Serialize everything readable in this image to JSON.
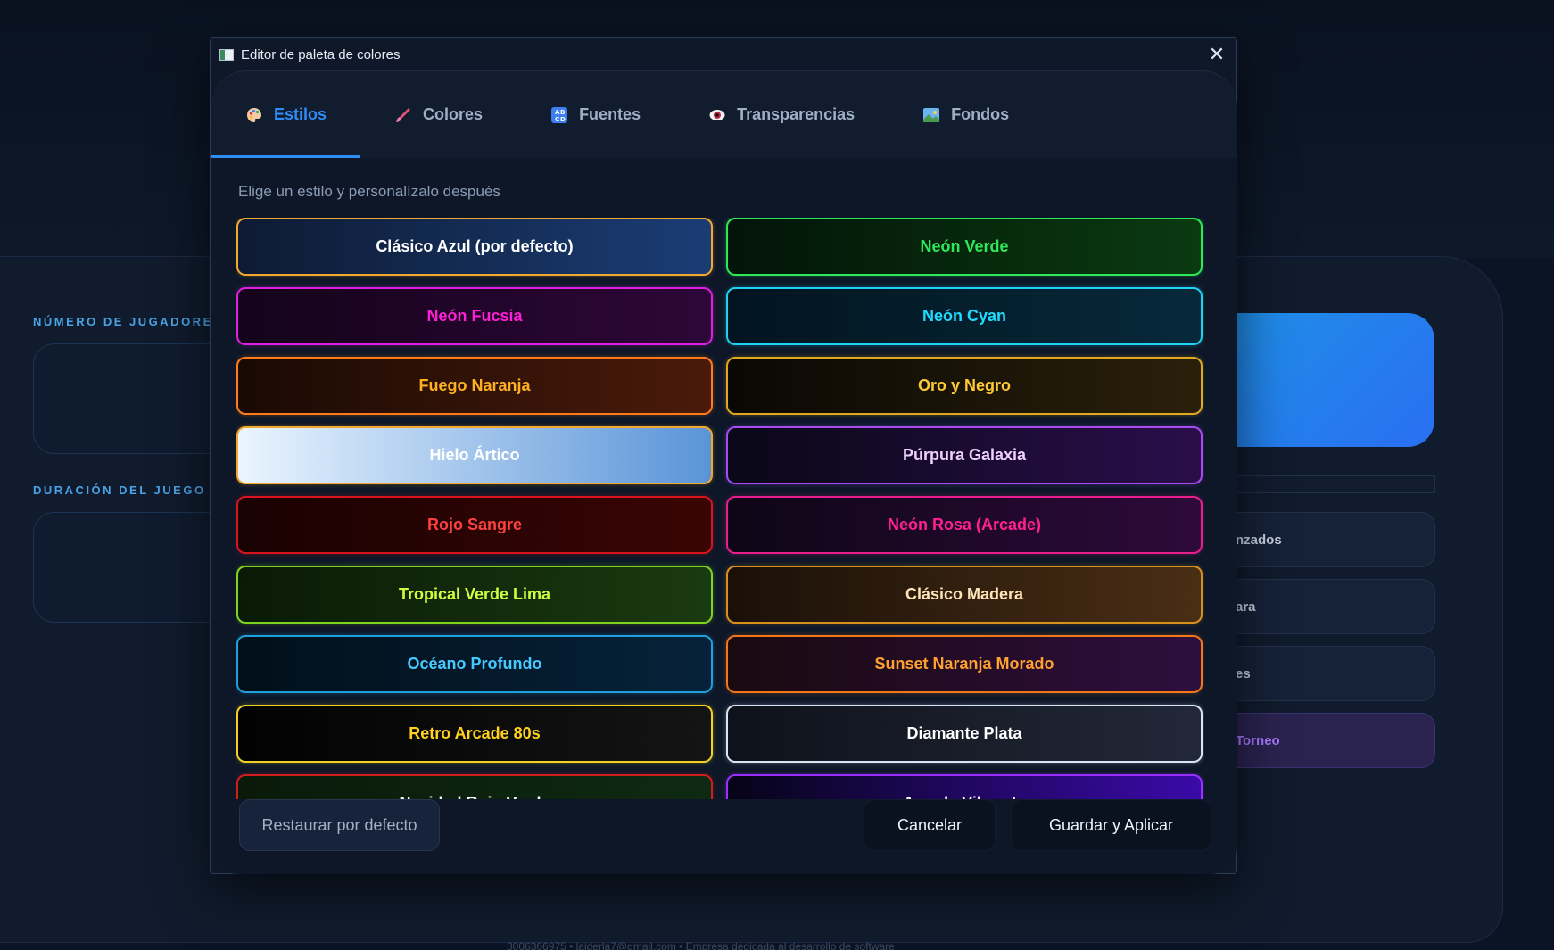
{
  "background": {
    "label_players": "NÚMERO DE JUGADORES",
    "label_duration": "DURACIÓN DEL JUEGO",
    "side_buttons": [
      "nzados",
      "ara",
      "es",
      "Torneo"
    ],
    "footer": "3006366975  •  laiderla7@gmail.com  •  Empresa dedicada al desarrollo de software"
  },
  "dialog": {
    "title": "Editor de paleta de colores",
    "close_symbol": "✕",
    "tabs": [
      {
        "label": "Estilos",
        "icon": "palette-icon",
        "active": true
      },
      {
        "label": "Colores",
        "icon": "brush-icon",
        "active": false
      },
      {
        "label": "Fuentes",
        "icon": "font-grid-icon",
        "active": false
      },
      {
        "label": "Transparencias",
        "icon": "eye-icon",
        "active": false
      },
      {
        "label": "Fondos",
        "icon": "picture-icon",
        "active": false
      }
    ],
    "subtitle": "Elige un estilo y personalízalo después",
    "styles": [
      {
        "name": "Clásico Azul (por defecto)",
        "text": "#ffffff",
        "border": "#f0a830",
        "bg1": "#0e1a33",
        "bg2": "#1a3d75"
      },
      {
        "name": "Neón Verde",
        "text": "#2ee85a",
        "border": "#2ee85a",
        "bg1": "#031408",
        "bg2": "#0a3a10"
      },
      {
        "name": "Neón Fucsia",
        "text": "#ff1fd6",
        "border": "#e01ee0",
        "bg1": "#14031a",
        "bg2": "#2e0738"
      },
      {
        "name": "Neón Cyan",
        "text": "#1fdcff",
        "border": "#1fd1f0",
        "bg1": "#021420",
        "bg2": "#06293a"
      },
      {
        "name": "Fuego Naranja",
        "text": "#ffb020",
        "border": "#ff7a18",
        "bg1": "#1a0a04",
        "bg2": "#4a1a0a"
      },
      {
        "name": "Oro y Negro",
        "text": "#ffc933",
        "border": "#e0a820",
        "bg1": "#0a0804",
        "bg2": "#2a200a"
      },
      {
        "name": "Hielo Ártico",
        "text": "#ffffff",
        "border": "#f0a830",
        "bg1": "#eaf5ff",
        "bg2": "#5a94d8"
      },
      {
        "name": "Púrpura Galaxia",
        "text": "#efd0ff",
        "border": "#a44cf0",
        "bg1": "#0a0818",
        "bg2": "#2a0e4a"
      },
      {
        "name": "Rojo Sangre",
        "text": "#ff4040",
        "border": "#d8141c",
        "bg1": "#1a0202",
        "bg2": "#3a0404"
      },
      {
        "name": "Neón Rosa (Arcade)",
        "text": "#ff1f8f",
        "border": "#e81e8e",
        "bg1": "#0e0616",
        "bg2": "#2e0a3a"
      },
      {
        "name": "Tropical Verde Lima",
        "text": "#d0ff40",
        "border": "#7ed321",
        "bg1": "#0a1a06",
        "bg2": "#1a3a10"
      },
      {
        "name": "Clásico Madera",
        "text": "#ffe4b8",
        "border": "#d8901c",
        "bg1": "#1a1008",
        "bg2": "#4a2e14"
      },
      {
        "name": "Océano Profundo",
        "text": "#46c9ff",
        "border": "#1ea0dc",
        "bg1": "#020f1a",
        "bg2": "#06223a"
      },
      {
        "name": "Sunset Naranja Morado",
        "text": "#ffa030",
        "border": "#f07818",
        "bg1": "#1a0a10",
        "bg2": "#2e0e3e"
      },
      {
        "name": "Retro Arcade 80s",
        "text": "#ffd21f",
        "border": "#f0d020",
        "bg1": "#020202",
        "bg2": "#141414"
      },
      {
        "name": "Diamante Plata",
        "text": "#ffffff",
        "border": "#d8e4f4",
        "bg1": "#0e121a",
        "bg2": "#222838"
      },
      {
        "name": "Navidad Rojo Verde",
        "text": "#ffffff",
        "border": "#d01e1e",
        "bg1": "#0a1a0a",
        "bg2": "#0e2a12"
      },
      {
        "name": "Arcade Vibrante",
        "text": "#ffffff",
        "border": "#9a30ff",
        "bg1": "#060418",
        "bg2": "#3a0aa8"
      }
    ],
    "buttons": {
      "restore": "Restaurar por defecto",
      "cancel": "Cancelar",
      "save": "Guardar y Aplicar"
    }
  }
}
